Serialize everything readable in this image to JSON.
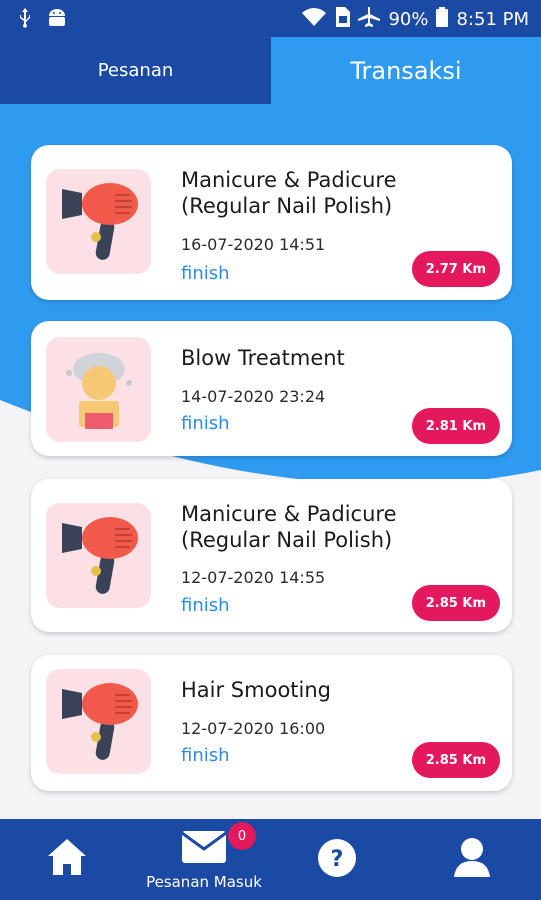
{
  "status_bar": {
    "battery": "90%",
    "time": "8:51 PM"
  },
  "tabs": [
    {
      "label": "Pesanan"
    },
    {
      "label": "Transaksi"
    }
  ],
  "cards": [
    {
      "title": "Manicure & Padicure (Regular Nail Polish)",
      "date": "16-07-2020 14:51",
      "status": "finish",
      "distance": "2.77 Km",
      "icon": "hair-dryer-icon"
    },
    {
      "title": "Blow Treatment",
      "date": "14-07-2020 23:24",
      "status": "finish",
      "distance": "2.81 Km",
      "icon": "hair-treatment-icon"
    },
    {
      "title": "Manicure & Padicure (Regular Nail Polish)",
      "date": "12-07-2020 14:55",
      "status": "finish",
      "distance": "2.85 Km",
      "icon": "hair-dryer-icon"
    },
    {
      "title": "Hair Smooting",
      "date": "12-07-2020 16:00",
      "status": "finish",
      "distance": "2.85 Km",
      "icon": "hair-dryer-icon"
    }
  ],
  "bottom_nav": {
    "inbox_label": "Pesanan Masuk",
    "inbox_badge": "0"
  },
  "colors": {
    "primary_dark": "#1a4aa3",
    "primary": "#2f9bf0",
    "accent": "#e4185c",
    "status": "#2b8be6"
  }
}
